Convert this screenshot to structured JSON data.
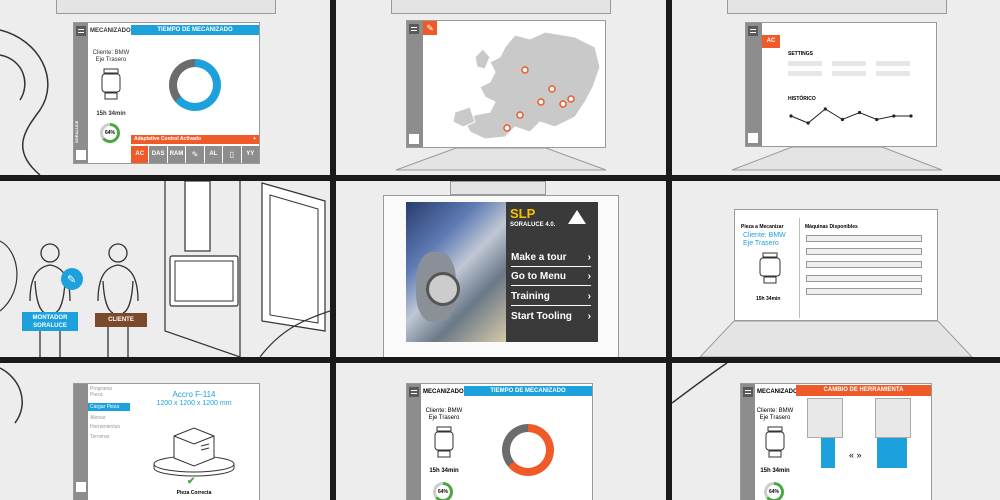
{
  "panel1": {
    "header_left": "MECANIZADO",
    "header_title": "TIEMPO DE MECANIZADO",
    "client_line1": "Cliente: BMW",
    "client_line2": "Eje Trasero",
    "time": "15h 34min",
    "percent": "64%",
    "status_bar": "Adaptative Control Activado",
    "buttons": [
      "AC",
      "DAS",
      "RAM",
      "",
      "AL",
      "",
      "YY"
    ],
    "brand": "SORALUCE",
    "progress": 0.64,
    "accent": "#1da1dd"
  },
  "panel3": {
    "tab": "AC",
    "settings": "SETTINGS",
    "historico": "HISTÓRICO",
    "history_values": [
      3,
      1,
      5,
      2,
      4,
      2,
      3,
      3
    ]
  },
  "panel4": {
    "role1": "MONTADOR SORALUCE",
    "role2": "CLIENTE"
  },
  "panel5": {
    "title": "SLP",
    "subtitle": "SORALUCE 4.0.",
    "menu": [
      "Make a tour",
      "Go to Menu",
      "Training",
      "Start Tooling"
    ]
  },
  "panel6": {
    "left_title": "Pieza a Mecanizar",
    "client": "Cliente: BMW",
    "part": "Eje Trasero",
    "time": "15h 34min",
    "right_title": "Máquinas Disponibles"
  },
  "panel7": {
    "steps": [
      "Programa Pieza",
      "Cargar Pieza",
      "Alinear",
      "Herramientas",
      "Terminar"
    ],
    "active_step": 1,
    "part_name": "Accro F-114",
    "dimensions": "1200 x 1200 x 1200 mm",
    "status": "Pieza Correcta"
  },
  "panel8": {
    "header_left": "MECANIZADO",
    "header_title": "TIEMPO DE MECANIZADO",
    "client_line1": "Cliente: BMW",
    "client_line2": "Eje Trasero",
    "time": "15h 34min",
    "percent": "64%",
    "accent": "#f05a28"
  },
  "panel9": {
    "header_left": "MECANIZADO",
    "header_title": "CAMBIO DE HERRAMIENTA",
    "client_line1": "Cliente: BMW",
    "client_line2": "Eje Trasero",
    "time": "15h 34min",
    "percent": "64%",
    "arrows": "« »"
  }
}
